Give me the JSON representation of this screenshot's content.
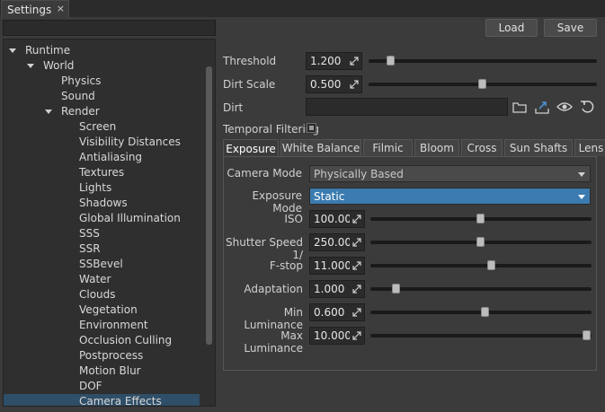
{
  "window_tab": {
    "title": "Settings",
    "close": "×"
  },
  "toolbar": {
    "load_label": "Load",
    "save_label": "Save"
  },
  "tree": [
    {
      "label": "Runtime",
      "level": 0,
      "expanded": true
    },
    {
      "label": "World",
      "level": 1,
      "expanded": true
    },
    {
      "label": "Physics",
      "level": 2
    },
    {
      "label": "Sound",
      "level": 2
    },
    {
      "label": "Render",
      "level": 2,
      "expanded": true
    },
    {
      "label": "Screen",
      "level": 3
    },
    {
      "label": "Visibility Distances",
      "level": 3
    },
    {
      "label": "Antialiasing",
      "level": 3
    },
    {
      "label": "Textures",
      "level": 3
    },
    {
      "label": "Lights",
      "level": 3
    },
    {
      "label": "Shadows",
      "level": 3
    },
    {
      "label": "Global Illumination",
      "level": 3
    },
    {
      "label": "SSS",
      "level": 3
    },
    {
      "label": "SSR",
      "level": 3
    },
    {
      "label": "SSBevel",
      "level": 3
    },
    {
      "label": "Water",
      "level": 3
    },
    {
      "label": "Clouds",
      "level": 3
    },
    {
      "label": "Vegetation",
      "level": 3
    },
    {
      "label": "Environment",
      "level": 3
    },
    {
      "label": "Occlusion Culling",
      "level": 3
    },
    {
      "label": "Postprocess",
      "level": 3
    },
    {
      "label": "Motion Blur",
      "level": 3
    },
    {
      "label": "DOF",
      "level": 3
    },
    {
      "label": "Camera Effects",
      "level": 3,
      "selected": true
    }
  ],
  "main": {
    "threshold": {
      "label": "Threshold",
      "value": "1.200",
      "slider": 0.08
    },
    "dirt_scale": {
      "label": "Dirt Scale",
      "value": "0.500",
      "slider": 0.5
    },
    "dirt": {
      "label": "Dirt",
      "value": ""
    },
    "temporal_filtering": {
      "label": "Temporal Filtering",
      "checked": true
    }
  },
  "subtabs": [
    "Exposure",
    "White Balance",
    "Filmic",
    "Bloom",
    "Cross",
    "Sun Shafts",
    "Lens"
  ],
  "exposure": {
    "camera_mode": {
      "label": "Camera Mode",
      "value": "Physically Based"
    },
    "exposure_mode": {
      "label": "Exposure Mode",
      "value": "Static"
    },
    "params": [
      {
        "label": "ISO",
        "value": "100.000",
        "slider": 0.5
      },
      {
        "label": "Shutter Speed 1/",
        "value": "250.000",
        "slider": 0.5
      },
      {
        "label": "F-stop",
        "value": "11.000",
        "slider": 0.55
      },
      {
        "label": "Adaptation",
        "value": "1.000",
        "slider": 0.1
      },
      {
        "label": "Min Luminance",
        "value": "0.600",
        "slider": 0.52
      },
      {
        "label": "Max Luminance",
        "value": "10.000",
        "slider": 1.0
      }
    ]
  },
  "colors": {
    "selection": "#2f4e67",
    "accent_combo": "#3c7bb0"
  },
  "icons": {
    "browse": "folder-icon",
    "upload": "upload-icon",
    "view": "eye-icon",
    "reset": "reset-icon"
  }
}
